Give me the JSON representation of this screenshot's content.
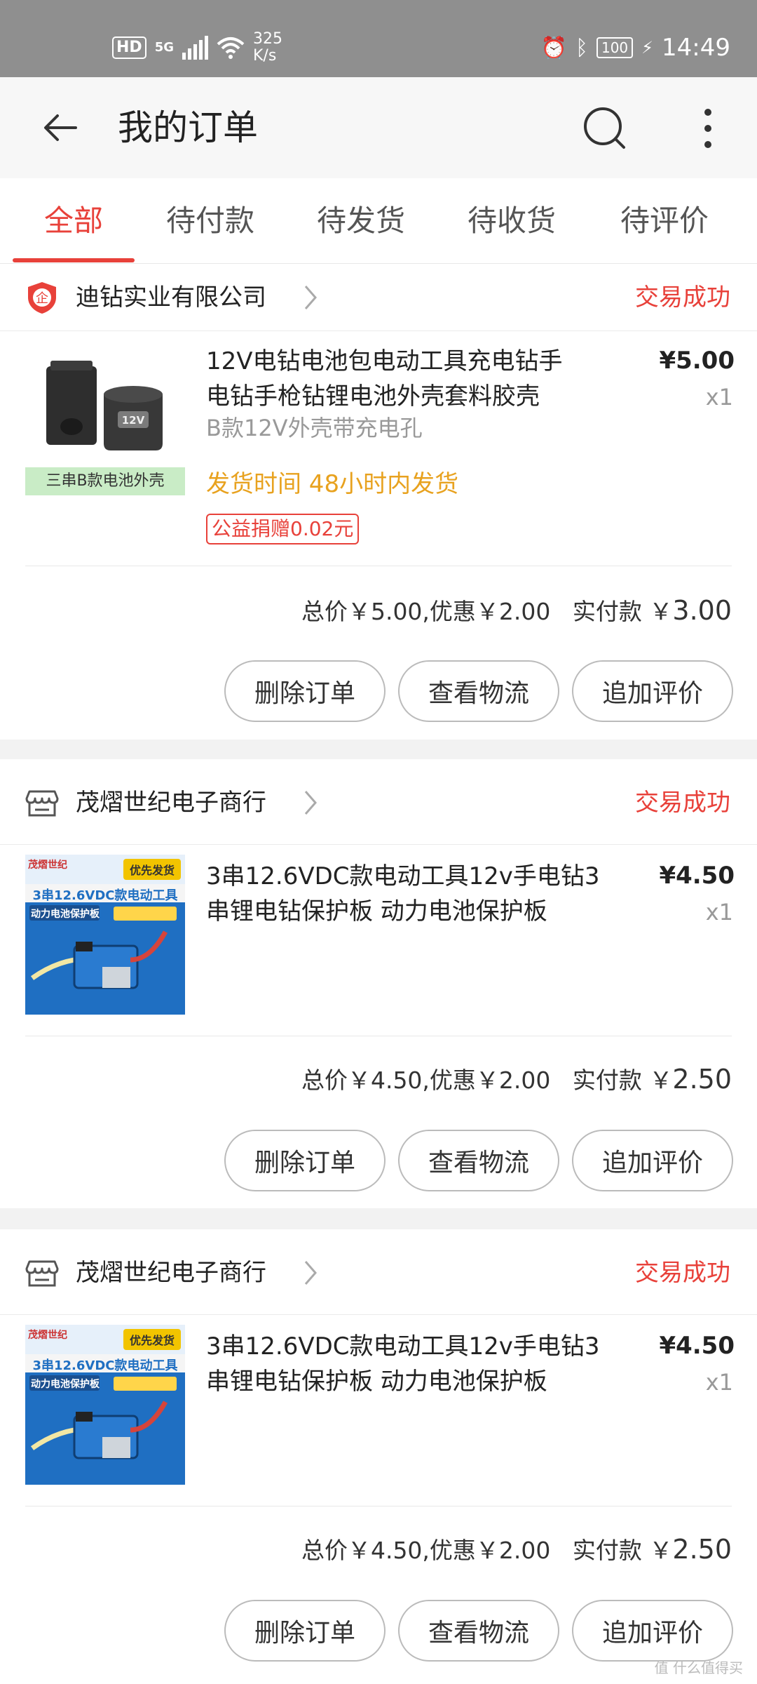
{
  "status_bar": {
    "hd": "HD",
    "network": "5G",
    "speed_value": "325",
    "speed_unit": "K/s",
    "battery": "100",
    "time": "14:49"
  },
  "header": {
    "title": "我的订单",
    "back_icon": "arrow-left-icon",
    "search_icon": "search-icon",
    "more_icon": "more-vertical-icon"
  },
  "tabs": [
    {
      "label": "全部",
      "active": true
    },
    {
      "label": "待付款",
      "active": false
    },
    {
      "label": "待发货",
      "active": false
    },
    {
      "label": "待收货",
      "active": false
    },
    {
      "label": "待评价",
      "active": false
    }
  ],
  "orders": [
    {
      "shop": "迪钻实业有限公司",
      "status": "交易成功",
      "title_line1": "12V电钻电池包电动工具充电钻手",
      "title_line2": "电钻手枪钻锂电池外壳套料胶壳",
      "variant": "B款12V外壳带充电孔",
      "thumb_caption": "三串B款电池外壳",
      "ship_time": "发货时间 48小时内发货",
      "charity": "公益捐赠0.02元",
      "price": "¥5.00",
      "qty": "x1",
      "totals": "总价￥5.00,优惠￥2.00",
      "paid_label": "实付款 ￥",
      "paid_value": "3.00"
    },
    {
      "shop": "茂熠世纪电子商行",
      "status": "交易成功",
      "title_line1": "3串12.6VDC款电动工具12v手电钻3",
      "title_line2": "串锂电钻保护板 动力电池保护板",
      "thumb_brand": "茂熠世纪",
      "thumb_tag": "优先发货",
      "thumb_banner": "3串12.6VDC款电动工具",
      "thumb_sub": "动力电池保护板",
      "price": "¥4.50",
      "qty": "x1",
      "totals": "总价￥4.50,优惠￥2.00",
      "paid_label": "实付款 ￥",
      "paid_value": "2.50"
    },
    {
      "shop": "茂熠世纪电子商行",
      "status": "交易成功",
      "title_line1": "3串12.6VDC款电动工具12v手电钻3",
      "title_line2": "串锂电钻保护板 动力电池保护板",
      "thumb_brand": "茂熠世纪",
      "thumb_tag": "优先发货",
      "thumb_banner": "3串12.6VDC款电动工具",
      "thumb_sub": "动力电池保护板",
      "price": "¥4.50",
      "qty": "x1",
      "totals": "总价￥4.50,优惠￥2.00",
      "paid_label": "实付款 ￥",
      "paid_value": "2.50"
    }
  ],
  "buttons": {
    "delete": "删除订单",
    "logistics": "查看物流",
    "review": "追加评价"
  },
  "watermark": "值 什么值得买",
  "colors": {
    "accent": "#e8413a",
    "ship_time": "#e8a21f",
    "status_bar": "#8f8f8f"
  }
}
